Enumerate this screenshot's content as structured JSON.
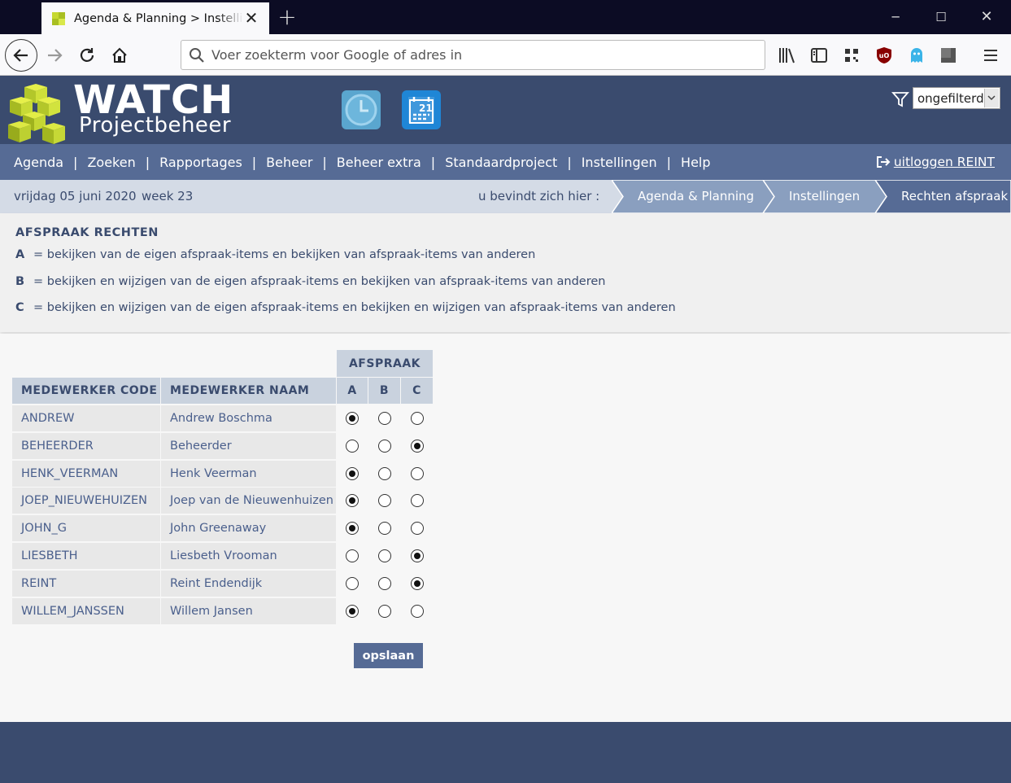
{
  "browser": {
    "tab_title": "Agenda & Planning > Instellingen",
    "new_tab": "+",
    "url_placeholder": "Voer zoekterm voor Google of adres in"
  },
  "header": {
    "logo_title": "WATCH",
    "logo_subtitle": "Projectbeheer",
    "filter_value": "ongefilterd"
  },
  "menu": {
    "items": [
      "Agenda",
      "Zoeken",
      "Rapportages",
      "Beheer",
      "Beheer extra",
      "Standaardproject",
      "Instellingen",
      "Help"
    ],
    "separator": "|",
    "logout": "uitloggen REINT"
  },
  "crumbbar": {
    "date": "vrijdag 05 juni 2020",
    "week": "week 23",
    "here_label": "u bevindt zich hier :",
    "crumbs": [
      "Agenda & Planning",
      "Instellingen",
      "Rechten afspraak"
    ]
  },
  "info": {
    "title": "AFSPRAAK RECHTEN",
    "lines": [
      {
        "key": "A",
        "text": "= bekijken van de eigen afspraak-items en bekijken van afspraak-items van anderen"
      },
      {
        "key": "B",
        "text": "= bekijken en wijzigen van de eigen afspraak-items en bekijken van afspraak-items van anderen"
      },
      {
        "key": "C",
        "text": "= bekijken en wijzigen van de eigen afspraak-items en bekijken en wijzigen van afspraak-items van anderen"
      }
    ]
  },
  "table": {
    "group_header": "AFSPRAAK",
    "headers": [
      "MEDEWERKER CODE",
      "MEDEWERKER NAAM",
      "A",
      "B",
      "C"
    ],
    "rows": [
      {
        "code": "ANDREW",
        "name": "Andrew Boschma",
        "selected": "A"
      },
      {
        "code": "BEHEERDER",
        "name": "Beheerder",
        "selected": "C"
      },
      {
        "code": "HENK_VEERMAN",
        "name": "Henk Veerman",
        "selected": "A"
      },
      {
        "code": "JOEP_NIEUWEHUIZEN",
        "name": "Joep van de Nieuwenhuizen",
        "selected": "A"
      },
      {
        "code": "JOHN_G",
        "name": "John Greenaway",
        "selected": "A"
      },
      {
        "code": "LIESBETH",
        "name": "Liesbeth Vrooman",
        "selected": "C"
      },
      {
        "code": "REINT",
        "name": "Reint Endendijk",
        "selected": "C"
      },
      {
        "code": "WILLEM_JANSSEN",
        "name": "Willem Jansen",
        "selected": "A"
      }
    ],
    "save_label": "opslaan"
  },
  "colors": {
    "header_bg": "#3a4b6e",
    "menu_bg": "#566b95",
    "crumb_bg": "#d4dbe6",
    "table_head_bg": "#c9d2de",
    "accent_text": "#3a4b6e"
  },
  "icons": [
    "firefox-favicon",
    "back-icon",
    "forward-icon",
    "reload-icon",
    "home-icon",
    "search-icon",
    "library-icon",
    "sidebar-icon",
    "qr-icon",
    "ublock-icon",
    "ghostery-icon",
    "extension-icon",
    "hamburger-icon",
    "clock-app-icon",
    "calendar-app-icon",
    "filter-icon",
    "logout-icon"
  ]
}
